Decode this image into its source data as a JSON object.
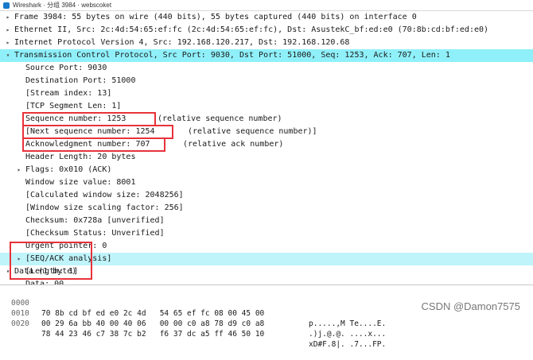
{
  "window": {
    "title": "Wireshark · 分组 3984 · webscoket"
  },
  "detail": {
    "frame": "Frame 3984: 55 bytes on wire (440 bits), 55 bytes captured (440 bits) on interface 0",
    "ethernet": "Ethernet II, Src: 2c:4d:54:65:ef:fc (2c:4d:54:65:ef:fc), Dst: AsustekC_bf:ed:e0 (70:8b:cd:bf:ed:e0)",
    "ip": "Internet Protocol Version 4, Src: 192.168.120.217, Dst: 192.168.120.68",
    "tcp": "Transmission Control Protocol, Src Port: 9030, Dst Port: 51000, Seq: 1253, Ack: 707, Len: 1",
    "tcp_fields": {
      "src_port": "Source Port: 9030",
      "dst_port": "Destination Port: 51000",
      "stream_index": "[Stream index: 13]",
      "segment_len": "[TCP Segment Len: 1]",
      "seq": "Sequence number: 1253",
      "seq_note": "(relative sequence number)",
      "next_seq": "[Next sequence number: 1254",
      "next_seq_note": "(relative sequence number)]",
      "ack": "Acknowledgment number: 707",
      "ack_note": "(relative ack number)",
      "header_len": "Header Length: 20 bytes",
      "flags": "Flags: 0x010 (ACK)",
      "window": "Window size value: 8001",
      "calc_window": "[Calculated window size: 2048256]",
      "scaling": "[Window size scaling factor: 256]",
      "checksum": "Checksum: 0x728a [unverified]",
      "checksum_status": "[Checksum Status: Unverified]",
      "urgent": "Urgent pointer: 0",
      "seq_ack": "[SEQ/ACK analysis]"
    },
    "data": "Data (1 byte)",
    "data_fields": {
      "data": "Data: 00",
      "length": "[Length: 1]"
    }
  },
  "hex": [
    {
      "offset": "0000",
      "bytes": "70 8b cd bf ed e0 2c 4d   54 65 ef fc 08 00 45 00",
      "ascii": "p.....,M Te....E."
    },
    {
      "offset": "0010",
      "bytes": "00 29 6a bb 40 00 40 06   00 00 c0 a8 78 d9 c0 a8",
      "ascii": ".)j.@.@. ....x..."
    },
    {
      "offset": "0020",
      "bytes": "78 44 23 46 c7 38 7c b2   f6 37 dc a5 ff 46 50 10",
      "ascii": "xD#F.8|. .7...FP."
    }
  ],
  "watermark": "CSDN @Damon7575",
  "colors": {
    "selected_row": "#8ff0fa",
    "annotation_box": "#e8323a"
  }
}
